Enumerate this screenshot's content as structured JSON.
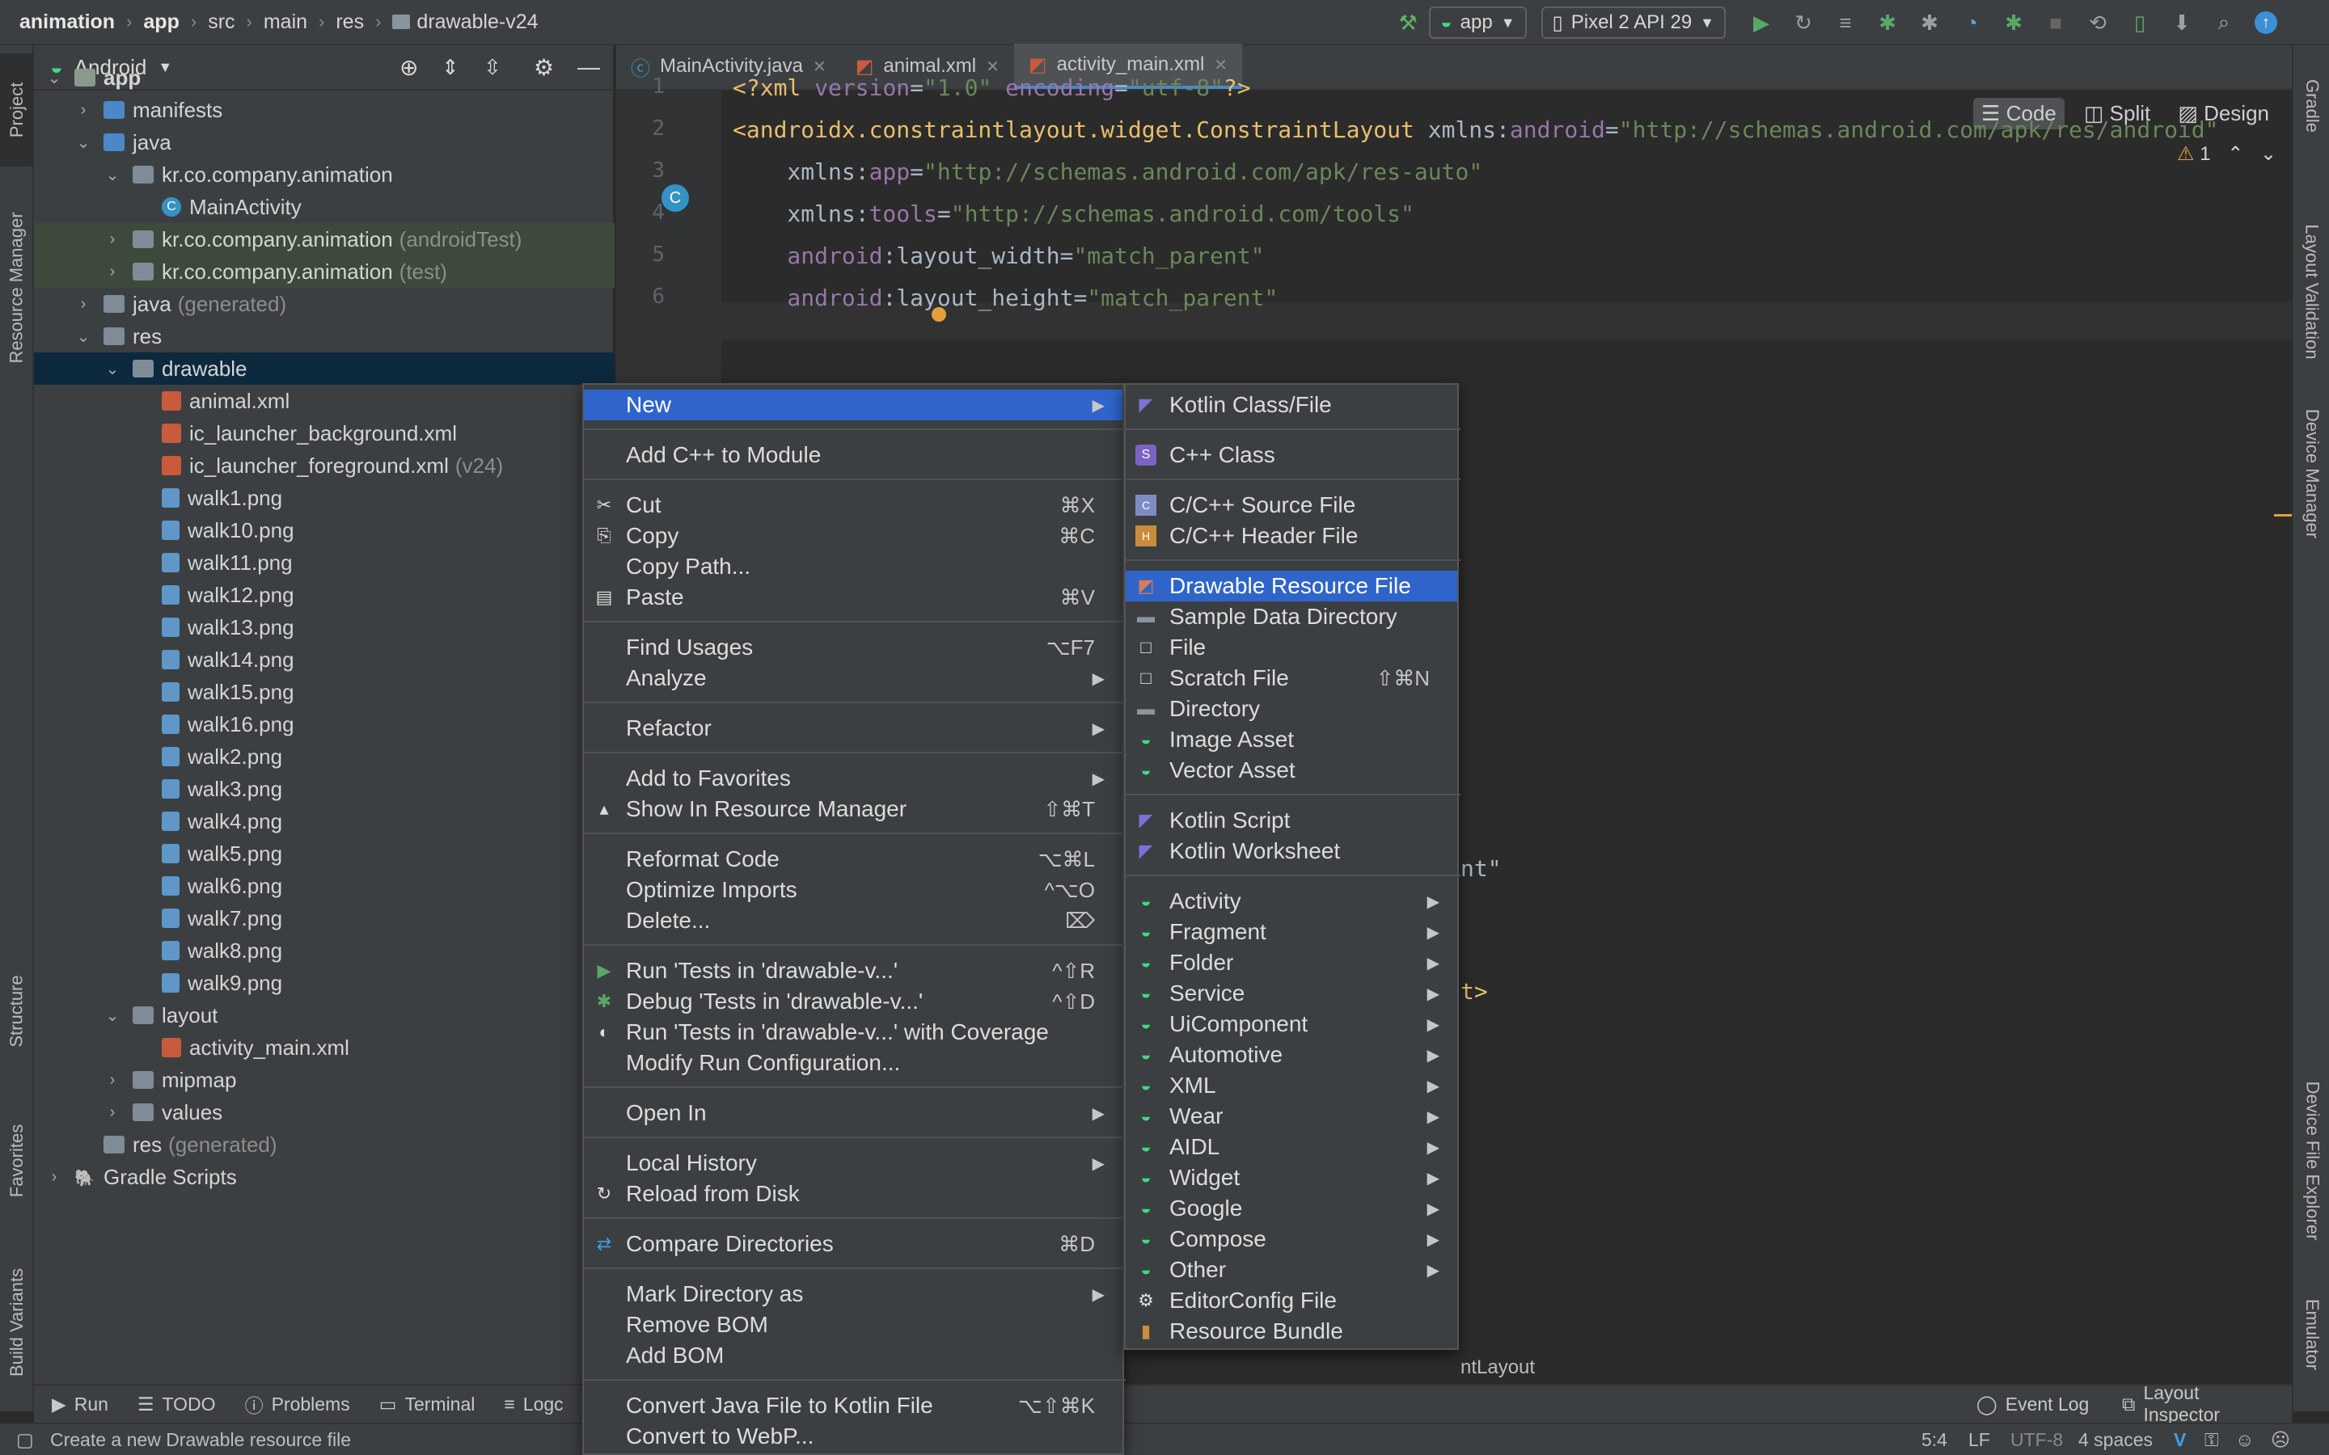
{
  "breadcrumb": [
    "animation",
    "app",
    "src",
    "main",
    "res",
    "drawable-v24"
  ],
  "toolbar": {
    "run_config": "app",
    "device": "Pixel 2 API 29"
  },
  "left_strip": {
    "project": "Project",
    "resource_manager": "Resource Manager",
    "structure": "Structure",
    "favorites": "Favorites",
    "build_variants": "Build Variants"
  },
  "right_strip": {
    "gradle": "Gradle",
    "layout_validation": "Layout Validation",
    "device_manager": "Device Manager",
    "device_file_explorer": "Device File Explorer",
    "emulator": "Emulator"
  },
  "project": {
    "view": "Android",
    "tree": [
      {
        "label": "app",
        "extra": "",
        "depth": 0,
        "icon": "module",
        "chev": "v"
      },
      {
        "label": "manifests",
        "extra": "",
        "depth": 1,
        "icon": "folder-blue",
        "chev": ">"
      },
      {
        "label": "java",
        "extra": "",
        "depth": 1,
        "icon": "folder-blue",
        "chev": "v"
      },
      {
        "label": "kr.co.company.animation",
        "extra": "",
        "depth": 2,
        "icon": "folder",
        "chev": "v"
      },
      {
        "label": "MainActivity",
        "extra": "",
        "depth": 3,
        "icon": "class",
        "chev": ""
      },
      {
        "label": "kr.co.company.animation",
        "extra": "(androidTest)",
        "depth": 2,
        "icon": "folder",
        "chev": ">",
        "hl": "green"
      },
      {
        "label": "kr.co.company.animation",
        "extra": "(test)",
        "depth": 2,
        "icon": "folder",
        "chev": ">",
        "hl": "green"
      },
      {
        "label": "java",
        "extra": "(generated)",
        "depth": 1,
        "icon": "folder",
        "chev": ">"
      },
      {
        "label": "res",
        "extra": "",
        "depth": 1,
        "icon": "folder",
        "chev": "v"
      },
      {
        "label": "drawable",
        "extra": "",
        "depth": 2,
        "icon": "folder",
        "chev": "v",
        "hl": "sel"
      },
      {
        "label": "animal.xml",
        "extra": "",
        "depth": 3,
        "icon": "xml",
        "chev": ""
      },
      {
        "label": "ic_launcher_background.xml",
        "extra": "",
        "depth": 3,
        "icon": "xml",
        "chev": ""
      },
      {
        "label": "ic_launcher_foreground.xml",
        "extra": "(v24)",
        "depth": 3,
        "icon": "xml",
        "chev": ""
      },
      {
        "label": "walk1.png",
        "extra": "",
        "depth": 3,
        "icon": "png",
        "chev": ""
      },
      {
        "label": "walk10.png",
        "extra": "",
        "depth": 3,
        "icon": "png",
        "chev": ""
      },
      {
        "label": "walk11.png",
        "extra": "",
        "depth": 3,
        "icon": "png",
        "chev": ""
      },
      {
        "label": "walk12.png",
        "extra": "",
        "depth": 3,
        "icon": "png",
        "chev": ""
      },
      {
        "label": "walk13.png",
        "extra": "",
        "depth": 3,
        "icon": "png",
        "chev": ""
      },
      {
        "label": "walk14.png",
        "extra": "",
        "depth": 3,
        "icon": "png",
        "chev": ""
      },
      {
        "label": "walk15.png",
        "extra": "",
        "depth": 3,
        "icon": "png",
        "chev": ""
      },
      {
        "label": "walk16.png",
        "extra": "",
        "depth": 3,
        "icon": "png",
        "chev": ""
      },
      {
        "label": "walk2.png",
        "extra": "",
        "depth": 3,
        "icon": "png",
        "chev": ""
      },
      {
        "label": "walk3.png",
        "extra": "",
        "depth": 3,
        "icon": "png",
        "chev": ""
      },
      {
        "label": "walk4.png",
        "extra": "",
        "depth": 3,
        "icon": "png",
        "chev": ""
      },
      {
        "label": "walk5.png",
        "extra": "",
        "depth": 3,
        "icon": "png",
        "chev": ""
      },
      {
        "label": "walk6.png",
        "extra": "",
        "depth": 3,
        "icon": "png",
        "chev": ""
      },
      {
        "label": "walk7.png",
        "extra": "",
        "depth": 3,
        "icon": "png",
        "chev": ""
      },
      {
        "label": "walk8.png",
        "extra": "",
        "depth": 3,
        "icon": "png",
        "chev": ""
      },
      {
        "label": "walk9.png",
        "extra": "",
        "depth": 3,
        "icon": "png",
        "chev": ""
      },
      {
        "label": "layout",
        "extra": "",
        "depth": 2,
        "icon": "folder",
        "chev": "v"
      },
      {
        "label": "activity_main.xml",
        "extra": "",
        "depth": 3,
        "icon": "xml",
        "chev": ""
      },
      {
        "label": "mipmap",
        "extra": "",
        "depth": 2,
        "icon": "folder",
        "chev": ">"
      },
      {
        "label": "values",
        "extra": "",
        "depth": 2,
        "icon": "folder",
        "chev": ">"
      },
      {
        "label": "res",
        "extra": "(generated)",
        "depth": 1,
        "icon": "folder",
        "chev": ""
      },
      {
        "label": "Gradle Scripts",
        "extra": "",
        "depth": 0,
        "icon": "gradle",
        "chev": ">"
      }
    ]
  },
  "tabs": [
    {
      "label": "MainActivity.java",
      "active": false
    },
    {
      "label": "animal.xml",
      "active": false
    },
    {
      "label": "activity_main.xml",
      "active": true
    }
  ],
  "view_modes": {
    "code": "Code",
    "split": "Split",
    "design": "Design"
  },
  "editor": {
    "warnings": "1",
    "lines": [
      {
        "n": "1",
        "parts": [
          [
            "kw",
            "<?xml "
          ],
          [
            "attr",
            "version"
          ],
          [
            "",
            "="
          ],
          [
            "str",
            "\"1.0\""
          ],
          [
            "attr",
            " encoding"
          ],
          [
            "",
            "="
          ],
          [
            "str",
            "\"utf-8\""
          ],
          [
            "kw",
            "?>"
          ]
        ]
      },
      {
        "n": "2",
        "parts": [
          [
            "kw",
            "<androidx.constraintlayout.widget.ConstraintLayout "
          ],
          [
            "",
            "xmlns:"
          ],
          [
            "ns",
            "android"
          ],
          [
            "",
            "="
          ],
          [
            "str",
            "\"http://schemas.android.com/apk/res/android\""
          ]
        ]
      },
      {
        "n": "3",
        "parts": [
          [
            "",
            "    xmlns:"
          ],
          [
            "ns",
            "app"
          ],
          [
            "",
            "="
          ],
          [
            "str",
            "\"http://schemas.android.com/apk/res-auto\""
          ]
        ]
      },
      {
        "n": "4",
        "parts": [
          [
            "",
            "    xmlns:"
          ],
          [
            "ns",
            "tools"
          ],
          [
            "",
            "="
          ],
          [
            "str",
            "\"http://schemas.android.com/tools\""
          ]
        ]
      },
      {
        "n": "5",
        "parts": [
          [
            "ns",
            "    android"
          ],
          [
            "",
            ":layout_width"
          ],
          [
            "",
            "="
          ],
          [
            "str",
            "\"match_parent\""
          ]
        ]
      },
      {
        "n": "6",
        "parts": [
          [
            "ns",
            "    android"
          ],
          [
            "",
            ":layout_height"
          ],
          [
            "",
            "="
          ],
          [
            "str",
            "\"match_parent\""
          ]
        ]
      }
    ],
    "peek1": "nt\"",
    "peek2": "t>",
    "breadcrumb": "ntLayout"
  },
  "context_menu": [
    {
      "label": "New",
      "sc": "",
      "sub": true,
      "hl": true,
      "icon": ""
    },
    {
      "sep": true
    },
    {
      "label": "Add C++ to Module",
      "sc": "",
      "icon": ""
    },
    {
      "sep": true
    },
    {
      "label": "Cut",
      "sc": "⌘X",
      "icon": "✂"
    },
    {
      "label": "Copy",
      "sc": "⌘C",
      "icon": "⎘"
    },
    {
      "label": "Copy Path...",
      "sc": "",
      "icon": ""
    },
    {
      "label": "Paste",
      "sc": "⌘V",
      "icon": "📋"
    },
    {
      "sep": true
    },
    {
      "label": "Find Usages",
      "sc": "⌥F7",
      "icon": ""
    },
    {
      "label": "Analyze",
      "sc": "",
      "sub": true,
      "icon": ""
    },
    {
      "sep": true
    },
    {
      "label": "Refactor",
      "sc": "",
      "sub": true,
      "icon": ""
    },
    {
      "sep": true
    },
    {
      "label": "Add to Favorites",
      "sc": "",
      "sub": true,
      "icon": ""
    },
    {
      "label": "Show In Resource Manager",
      "sc": "⇧⌘T",
      "icon": "▴"
    },
    {
      "sep": true
    },
    {
      "label": "Reformat Code",
      "sc": "⌥⌘L",
      "icon": ""
    },
    {
      "label": "Optimize Imports",
      "sc": "^⌥O",
      "icon": ""
    },
    {
      "label": "Delete...",
      "sc": "⌦",
      "icon": ""
    },
    {
      "sep": true
    },
    {
      "label": "Run 'Tests in 'drawable-v...'",
      "sc": "^⇧R",
      "icon": "▶"
    },
    {
      "label": "Debug 'Tests in 'drawable-v...'",
      "sc": "^⇧D",
      "icon": "✱"
    },
    {
      "label": "Run 'Tests in 'drawable-v...' with Coverage",
      "sc": "",
      "icon": "◐"
    },
    {
      "label": "Modify Run Configuration...",
      "sc": "",
      "icon": ""
    },
    {
      "sep": true
    },
    {
      "label": "Open In",
      "sc": "",
      "sub": true,
      "icon": ""
    },
    {
      "sep": true
    },
    {
      "label": "Local History",
      "sc": "",
      "sub": true,
      "icon": ""
    },
    {
      "label": "Reload from Disk",
      "sc": "",
      "icon": "↻"
    },
    {
      "sep": true
    },
    {
      "label": "Compare Directories",
      "sc": "⌘D",
      "icon": "⇄"
    },
    {
      "sep": true
    },
    {
      "label": "Mark Directory as",
      "sc": "",
      "sub": true,
      "icon": ""
    },
    {
      "label": "Remove BOM",
      "sc": "",
      "icon": ""
    },
    {
      "label": "Add BOM",
      "sc": "",
      "icon": ""
    },
    {
      "sep": true
    },
    {
      "label": "Convert Java File to Kotlin File",
      "sc": "⌥⇧⌘K",
      "icon": ""
    },
    {
      "label": "Convert to WebP...",
      "sc": "",
      "icon": ""
    }
  ],
  "submenu": [
    {
      "label": "Kotlin Class/File",
      "sc": "",
      "icon": "K"
    },
    {
      "sep": true
    },
    {
      "label": "C++ Class",
      "sc": "",
      "icon": "S"
    },
    {
      "sep": true
    },
    {
      "label": "C/C++ Source File",
      "sc": "",
      "icon": "C"
    },
    {
      "label": "C/C++ Header File",
      "sc": "",
      "icon": "H"
    },
    {
      "sep": true
    },
    {
      "label": "Drawable Resource File",
      "sc": "",
      "icon": "X",
      "hl": true
    },
    {
      "label": "Sample Data Directory",
      "sc": "",
      "icon": "F"
    },
    {
      "label": "File",
      "sc": "",
      "icon": "□"
    },
    {
      "label": "Scratch File",
      "sc": "⇧⌘N",
      "icon": "□"
    },
    {
      "label": "Directory",
      "sc": "",
      "icon": "F"
    },
    {
      "label": "Image Asset",
      "sc": "",
      "icon": "A"
    },
    {
      "label": "Vector Asset",
      "sc": "",
      "icon": "A"
    },
    {
      "sep": true
    },
    {
      "label": "Kotlin Script",
      "sc": "",
      "icon": "K"
    },
    {
      "label": "Kotlin Worksheet",
      "sc": "",
      "icon": "K"
    },
    {
      "sep": true
    },
    {
      "label": "Activity",
      "sub": true,
      "icon": "A"
    },
    {
      "label": "Fragment",
      "sub": true,
      "icon": "A"
    },
    {
      "label": "Folder",
      "sub": true,
      "icon": "A"
    },
    {
      "label": "Service",
      "sub": true,
      "icon": "A"
    },
    {
      "label": "UiComponent",
      "sub": true,
      "icon": "A"
    },
    {
      "label": "Automotive",
      "sub": true,
      "icon": "A"
    },
    {
      "label": "XML",
      "sub": true,
      "icon": "A"
    },
    {
      "label": "Wear",
      "sub": true,
      "icon": "A"
    },
    {
      "label": "AIDL",
      "sub": true,
      "icon": "A"
    },
    {
      "label": "Widget",
      "sub": true,
      "icon": "A"
    },
    {
      "label": "Google",
      "sub": true,
      "icon": "A"
    },
    {
      "label": "Compose",
      "sub": true,
      "icon": "A"
    },
    {
      "label": "Other",
      "sub": true,
      "icon": "A"
    },
    {
      "label": "EditorConfig File",
      "sc": "",
      "icon": "⚙"
    },
    {
      "label": "Resource Bundle",
      "sc": "",
      "icon": "▮"
    }
  ],
  "bottom_tabs": [
    "Run",
    "TODO",
    "Problems",
    "Terminal",
    "Logc"
  ],
  "bottom_right": [
    "Event Log",
    "Layout Inspector"
  ],
  "status": {
    "message": "Create a new Drawable resource file",
    "pos": "5:4",
    "lf": "LF",
    "enc": "UTF-8",
    "indent": "4 spaces"
  }
}
